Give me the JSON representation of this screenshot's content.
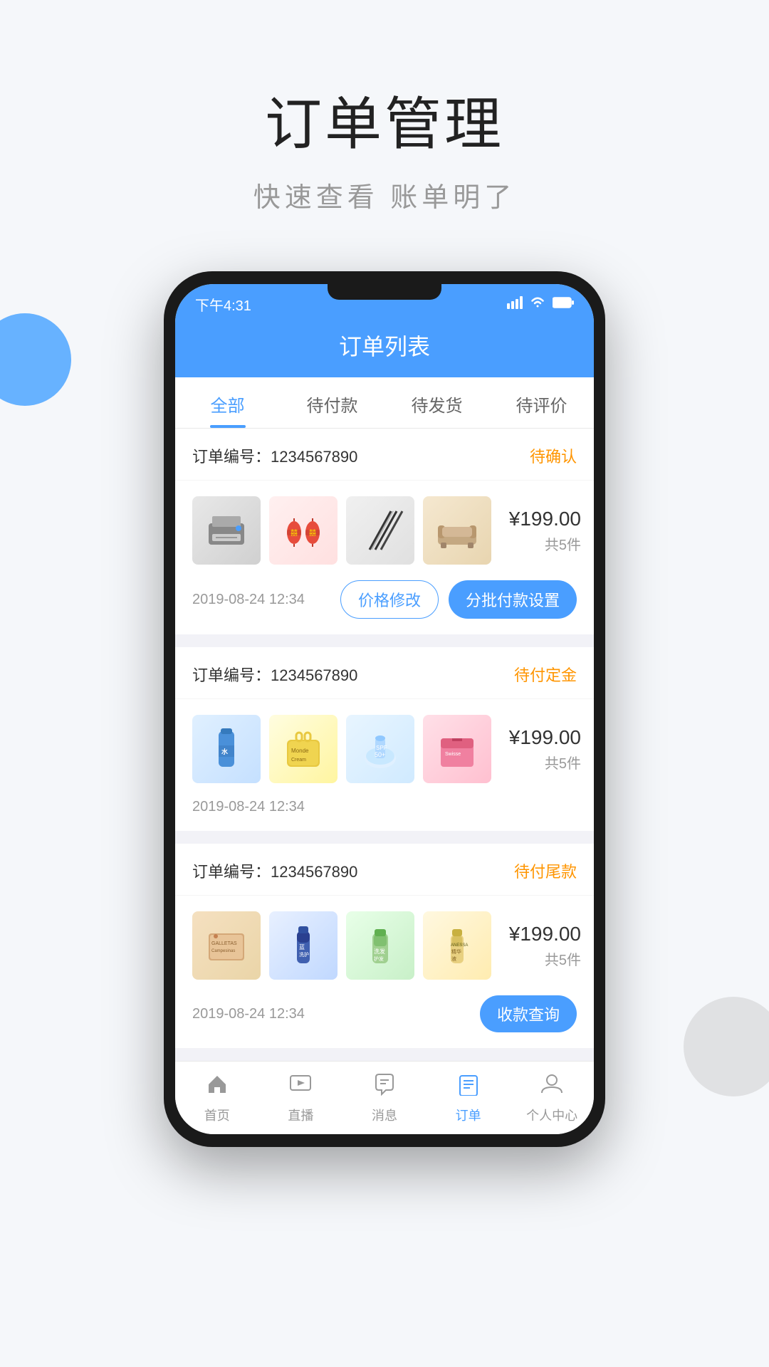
{
  "hero": {
    "title": "订单管理",
    "subtitle": "快速查看  账单明了"
  },
  "phone": {
    "status_bar": {
      "time": "下午4:31",
      "signal": "📶",
      "wifi": "📡",
      "battery": "🔋"
    },
    "header": {
      "title": "订单列表"
    },
    "tabs": [
      {
        "label": "全部",
        "active": true
      },
      {
        "label": "待付款",
        "active": false
      },
      {
        "label": "待发货",
        "active": false
      },
      {
        "label": "待评价",
        "active": false
      }
    ],
    "orders": [
      {
        "id": "order-1",
        "number_label": "订单编号：",
        "number": "1234567890",
        "status": "待确认",
        "status_class": "status-orange",
        "price": "¥199.00",
        "count": "共5件",
        "date": "2019-08-24 12:34",
        "actions": [
          {
            "label": "价格修改",
            "type": "outline"
          },
          {
            "label": "分批付款设置",
            "type": "solid"
          }
        ]
      },
      {
        "id": "order-2",
        "number_label": "订单编号：",
        "number": "1234567890",
        "status": "待付定金",
        "status_class": "status-orange",
        "price": "¥199.00",
        "count": "共5件",
        "date": "2019-08-24 12:34",
        "actions": []
      },
      {
        "id": "order-3",
        "number_label": "订单编号：",
        "number": "1234567890",
        "status": "待付尾款",
        "status_class": "status-orange",
        "price": "¥199.00",
        "count": "共5件",
        "date": "2019-08-24 12:34",
        "actions": [
          {
            "label": "收款查询",
            "type": "solid"
          }
        ]
      }
    ],
    "bottom_nav": [
      {
        "label": "首页",
        "icon": "⌂",
        "active": false
      },
      {
        "label": "直播",
        "icon": "▶",
        "active": false
      },
      {
        "label": "消息",
        "icon": "💬",
        "active": false
      },
      {
        "label": "订单",
        "icon": "≡",
        "active": true
      },
      {
        "label": "个人中心",
        "icon": "👤",
        "active": false
      }
    ]
  }
}
